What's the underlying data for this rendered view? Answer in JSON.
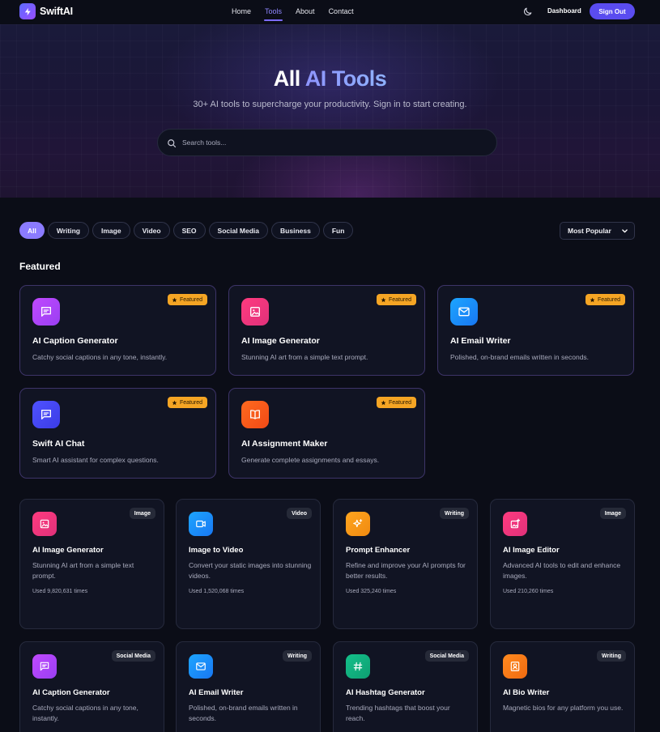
{
  "brand": {
    "name": "SwiftAI"
  },
  "nav": {
    "links": [
      "Home",
      "Tools",
      "About",
      "Contact"
    ],
    "active": "Tools",
    "dashboard": "Dashboard",
    "sign_out": "Sign Out"
  },
  "hero": {
    "title_plain": "All ",
    "title_accent": "AI Tools",
    "subtitle": "30+ AI tools to supercharge your productivity. Sign in to start creating.",
    "search_placeholder": "Search tools..."
  },
  "filters": {
    "chips": [
      "All",
      "Writing",
      "Image",
      "Video",
      "SEO",
      "Social Media",
      "Business",
      "Fun"
    ],
    "active": "All",
    "sort": "Most Popular"
  },
  "featured": {
    "heading": "Featured",
    "badge": "Featured",
    "cards": [
      {
        "title": "AI Caption Generator",
        "desc": "Catchy social captions in any tone, instantly.",
        "icon": "message-icon",
        "color": "#c049ff"
      },
      {
        "title": "AI Image Generator",
        "desc": "Stunning AI art from a simple text prompt.",
        "icon": "image-icon",
        "color": "#ff3b7f"
      },
      {
        "title": "AI Email Writer",
        "desc": "Polished, on-brand emails written in seconds.",
        "icon": "mail-icon",
        "color": "#1da5ff"
      },
      {
        "title": "Swift AI Chat",
        "desc": "Smart AI assistant for complex questions.",
        "icon": "message-icon",
        "color": "#4f52ff"
      },
      {
        "title": "AI Assignment Maker",
        "desc": "Generate complete assignments and essays.",
        "icon": "book-icon",
        "color": "#ff6a1f"
      }
    ]
  },
  "tools": [
    {
      "title": "AI Image Generator",
      "desc": "Stunning AI art from a simple text prompt.",
      "tag": "Image",
      "used": "Used 9,820,631 times",
      "icon": "image-icon"
    },
    {
      "title": "Image to Video",
      "desc": "Convert your static images into stunning videos.",
      "tag": "Video",
      "used": "Used 1,520,068 times",
      "icon": "video-icon"
    },
    {
      "title": "Prompt Enhancer",
      "desc": "Refine and improve your AI prompts for better results.",
      "tag": "Writing",
      "used": "Used 325,240 times",
      "icon": "sparkles-icon"
    },
    {
      "title": "AI Image Editor",
      "desc": "Advanced AI tools to edit and enhance images.",
      "tag": "Image",
      "used": "Used 210,260 times",
      "icon": "image-edit-icon"
    },
    {
      "title": "AI Caption Generator",
      "desc": "Catchy social captions in any tone, instantly.",
      "tag": "Social Media",
      "used": "",
      "icon": "message-icon"
    },
    {
      "title": "AI Email Writer",
      "desc": "Polished, on-brand emails written in seconds.",
      "tag": "Writing",
      "used": "",
      "icon": "mail-icon"
    },
    {
      "title": "AI Hashtag Generator",
      "desc": "Trending hashtags that boost your reach.",
      "tag": "Social Media",
      "used": "",
      "icon": "hash-icon"
    },
    {
      "title": "AI Bio Writer",
      "desc": "Magnetic bios for any platform you use.",
      "tag": "Writing",
      "used": "",
      "icon": "user-card-icon"
    }
  ]
}
